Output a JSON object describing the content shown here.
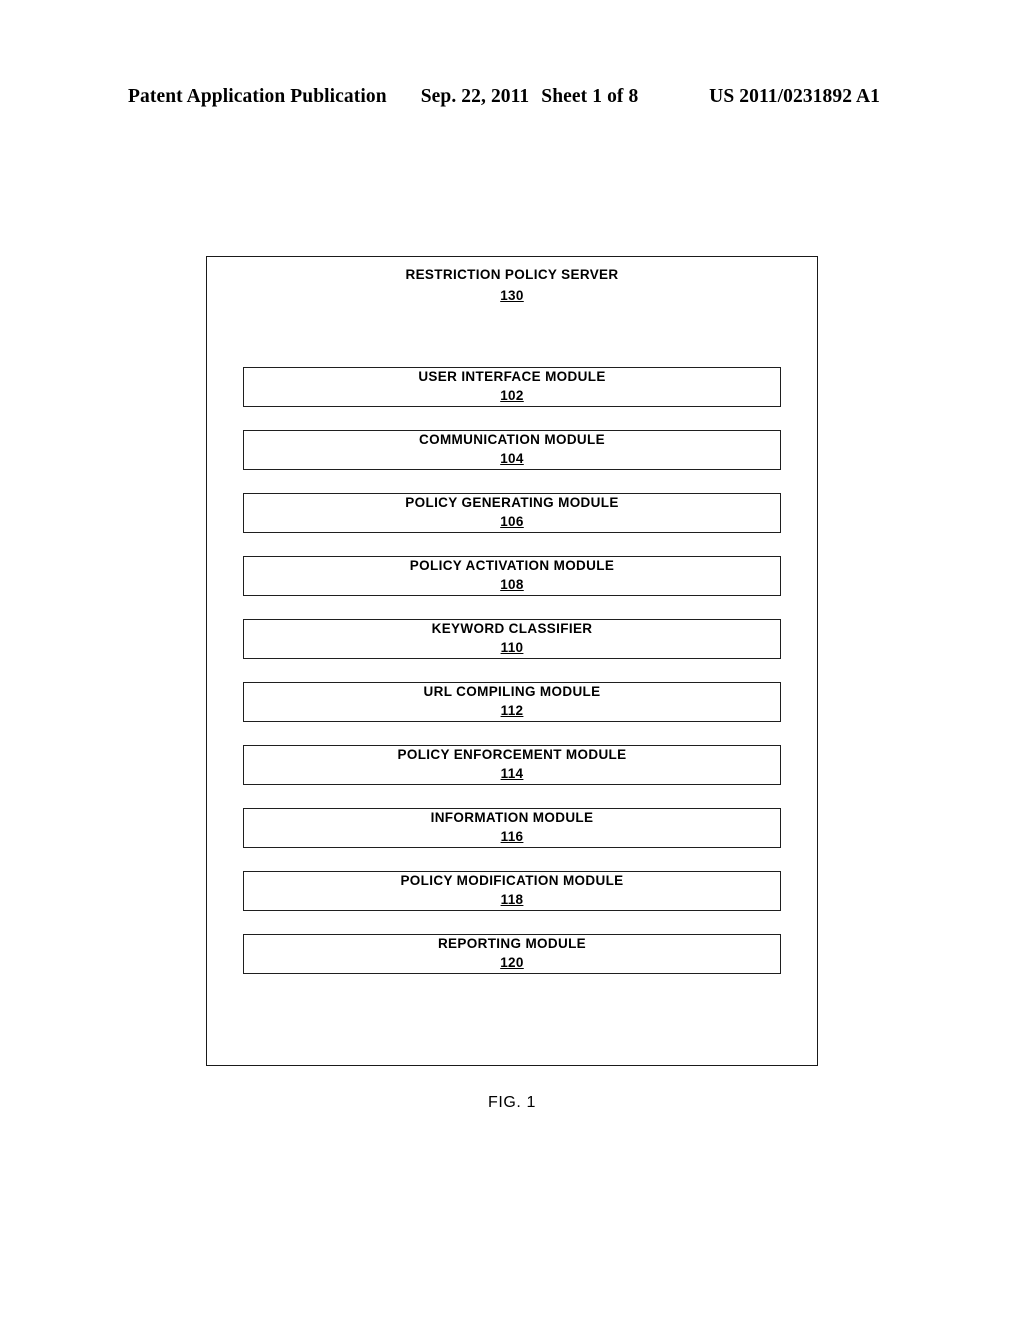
{
  "header": {
    "publication": "Patent Application Publication",
    "date": "Sep. 22, 2011",
    "sheet": "Sheet 1 of 8",
    "patent_number": "US 2011/0231892 A1"
  },
  "figure": {
    "caption": "FIG. 1",
    "server": {
      "title": "RESTRICTION POLICY SERVER",
      "ref": "130"
    },
    "modules": [
      {
        "label": "USER INTERFACE MODULE",
        "ref": "102"
      },
      {
        "label": "COMMUNICATION MODULE",
        "ref": "104"
      },
      {
        "label": "POLICY GENERATING MODULE",
        "ref": "106"
      },
      {
        "label": "POLICY ACTIVATION MODULE",
        "ref": "108"
      },
      {
        "label": "KEYWORD CLASSIFIER",
        "ref": "110"
      },
      {
        "label": "URL COMPILING MODULE",
        "ref": "112"
      },
      {
        "label": "POLICY ENFORCEMENT MODULE",
        "ref": "114"
      },
      {
        "label": "INFORMATION MODULE",
        "ref": "116"
      },
      {
        "label": "POLICY MODIFICATION MODULE",
        "ref": "118"
      },
      {
        "label": "REPORTING MODULE",
        "ref": "120"
      }
    ]
  }
}
